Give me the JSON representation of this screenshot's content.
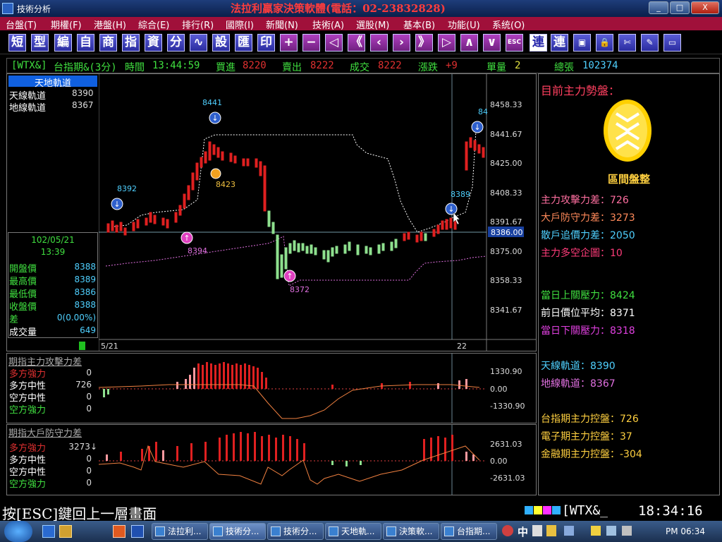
{
  "window": {
    "title": "技術分析",
    "banner": "法拉利贏家決策軟體(電話：02-23832828)",
    "min": "_",
    "max": "□",
    "close": "X"
  },
  "menu": [
    "台盤(T)",
    "期權(F)",
    "港盤(H)",
    "綜合(E)",
    "排行(R)",
    "國際(I)",
    "新聞(N)",
    "技術(A)",
    "選股(M)",
    "基本(B)",
    "功能(U)",
    "系统(O)"
  ],
  "toolbar": [
    "短",
    "型",
    "編",
    "自",
    "商",
    "指",
    "資",
    "分",
    "∿",
    "設",
    "匯",
    "印",
    "+",
    "−",
    "◁",
    "《",
    "‹",
    "›",
    "》",
    "▷",
    "∧",
    "∨",
    "ESC",
    "連",
    "連",
    "▣",
    "🔒",
    "✄",
    "✎",
    "▭"
  ],
  "info": {
    "symbol": "[WTX&]",
    "name": "台指期&(3分)",
    "time_label": "時間",
    "time": "13:44:59",
    "bid_label": "買進",
    "bid": "8220",
    "ask_label": "賣出",
    "ask": "8222",
    "deal_label": "成交",
    "deal": "8222",
    "change_label": "漲跌",
    "change": "+9",
    "vol_label": "單量",
    "vol": "2",
    "total_label": "總張",
    "total": "102374"
  },
  "legend": {
    "title": "天地軌道",
    "upper_label": "天線軌道",
    "upper": "8390",
    "lower_label": "地線軌道",
    "lower": "8367"
  },
  "quote": {
    "date": "102/05/21",
    "time": "13:39",
    "rows": [
      {
        "label": "開盤價",
        "value": "8388"
      },
      {
        "label": "最高價",
        "value": "8389"
      },
      {
        "label": "最低價",
        "value": "8386"
      },
      {
        "label": "收盤價",
        "value": "8388"
      },
      {
        "label": "差",
        "value": "0(0.00%)"
      },
      {
        "label": "成交量",
        "value": "649"
      }
    ]
  },
  "chart_data": {
    "type": "candlestick",
    "y_ticks": [
      "8458.33",
      "8441.67",
      "8425.00",
      "8408.33",
      "8391.67",
      "8375.00",
      "8358.33",
      "8341.67"
    ],
    "current_price": "8386.00",
    "x_labels": [
      "5/21",
      "22"
    ],
    "markers": [
      "8441",
      "8392",
      "8423",
      "8394",
      "8372",
      "8389",
      "84"
    ]
  },
  "ind1": {
    "title": "期指主力攻擊力差",
    "rows": [
      {
        "label": "多方強力",
        "value": "0"
      },
      {
        "label": "多方中性",
        "value": "726"
      },
      {
        "label": "空方中性",
        "value": "0"
      },
      {
        "label": "空方強力",
        "value": "0"
      }
    ],
    "ticks": [
      "1330.90",
      "0.00",
      "-1330.90"
    ]
  },
  "ind2": {
    "title": "期指大戶防守力差",
    "rows": [
      {
        "label": "多方強力",
        "value": "3273↓"
      },
      {
        "label": "多方中性",
        "value": "0"
      },
      {
        "label": "空方中性",
        "value": "0"
      },
      {
        "label": "空方強力",
        "value": "0"
      }
    ],
    "ticks": [
      "2631.03",
      "0.00",
      "-2631.03"
    ]
  },
  "right": {
    "title": "目前主力勢盤：",
    "badge": "區間盤整",
    "lines": [
      {
        "text": "主力攻擊力差：726",
        "color": "#ff6fa0"
      },
      {
        "text": "大戶防守力差：3273",
        "color": "#ff8a5a"
      },
      {
        "text": "散戶追價力差：2050",
        "color": "#4fd0ff"
      },
      {
        "text": "主力多空企圖：10",
        "color": "#ff3c7a"
      },
      {
        "text": "當日上關壓力：8424",
        "color": "#40e040"
      },
      {
        "text": "前日價位平均：8371",
        "color": "#ffffff"
      },
      {
        "text": "當日下關壓力：8318",
        "color": "#e040e0"
      },
      {
        "text": "天線軌道：8390",
        "color": "#4fd0ff"
      },
      {
        "text": "地線軌道：8367",
        "color": "#e070e0"
      },
      {
        "text": "台指期主力控盤：726",
        "color": "#ffd040"
      },
      {
        "text": "電子期主力控盤：37",
        "color": "#ffd040"
      },
      {
        "text": "金融期主力控盤：-304",
        "color": "#ffd040"
      }
    ]
  },
  "status": {
    "hint": "按[ESC]鍵回上一層畫面",
    "symbol": "[WTX&_",
    "clock": "18:34:16"
  },
  "taskbar": {
    "tasks": [
      "法拉利...",
      "技術分...",
      "技術分...",
      "天地軌...",
      "決策軟...",
      "台指期..."
    ],
    "ime": "中",
    "time": "PM 06:34"
  }
}
